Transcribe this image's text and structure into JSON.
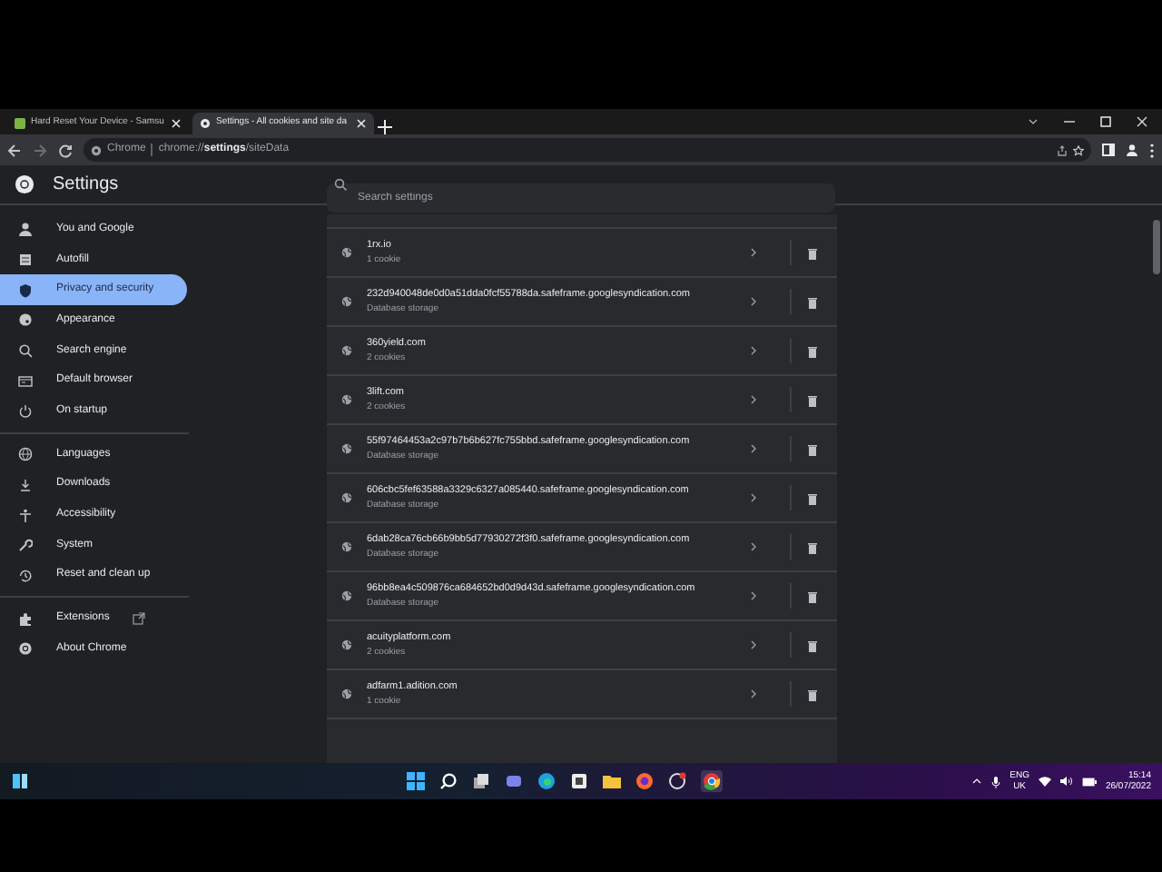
{
  "tabs": [
    {
      "title": "Hard Reset Your Device - Samsu",
      "selected": false
    },
    {
      "title": "Settings - All cookies and site da",
      "selected": true
    }
  ],
  "address_bar": {
    "site": "Chrome",
    "url": "chrome://**settings**/siteData"
  },
  "header": {
    "title": "Settings",
    "search_placeholder": "Search settings"
  },
  "sidebar": {
    "groups": [
      [
        {
          "label": "You and Google",
          "selected": false
        },
        {
          "label": "Autofill",
          "selected": false
        },
        {
          "label": "Privacy and security",
          "selected": true
        },
        {
          "label": "Appearance",
          "selected": false
        },
        {
          "label": "Search engine",
          "selected": false
        },
        {
          "label": "Default browser",
          "selected": false
        },
        {
          "label": "On startup",
          "selected": false
        }
      ],
      [
        {
          "label": "Languages",
          "selected": false
        },
        {
          "label": "Downloads",
          "selected": false
        },
        {
          "label": "Accessibility",
          "selected": false
        },
        {
          "label": "System",
          "selected": false
        },
        {
          "label": "Reset and clean up",
          "selected": false
        }
      ],
      [
        {
          "label": "Extensions",
          "selected": false,
          "external": true
        },
        {
          "label": "About Chrome",
          "selected": false
        }
      ]
    ]
  },
  "sites": [
    {
      "name": "1rx.io",
      "detail": "1 cookie"
    },
    {
      "name": "232d940048de0d0a51dda0fcf55788da.safeframe.googlesyndication.com",
      "detail": "Database storage"
    },
    {
      "name": "360yield.com",
      "detail": "2 cookies"
    },
    {
      "name": "3lift.com",
      "detail": "2 cookies"
    },
    {
      "name": "55f97464453a2c97b7b6b627fc755bbd.safeframe.googlesyndication.com",
      "detail": "Database storage"
    },
    {
      "name": "606cbc5fef63588a3329c6327a085440.safeframe.googlesyndication.com",
      "detail": "Database storage"
    },
    {
      "name": "6dab28ca76cb66b9bb5d77930272f3f0.safeframe.googlesyndication.com",
      "detail": "Database storage"
    },
    {
      "name": "96bb8ea4c509876ca684652bd0d9d43d.safeframe.googlesyndication.com",
      "detail": "Database storage"
    },
    {
      "name": "acuityplatform.com",
      "detail": "2 cookies"
    },
    {
      "name": "adfarm1.adition.com",
      "detail": "1 cookie"
    }
  ],
  "taskbar": {
    "language": "ENG",
    "region": "UK",
    "time": "15:14",
    "date": "26/07/2022"
  }
}
